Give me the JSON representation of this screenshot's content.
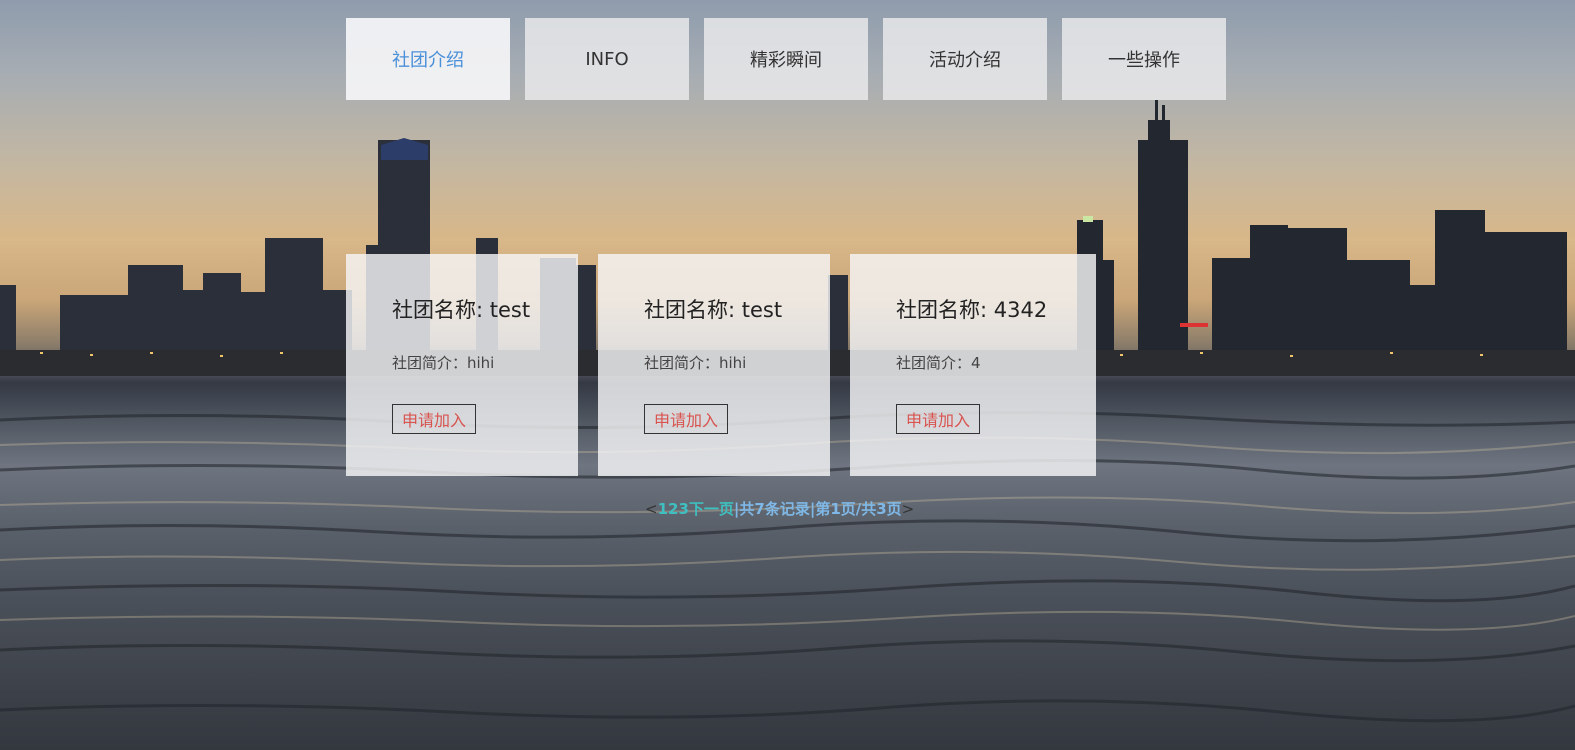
{
  "nav": {
    "items": [
      {
        "label": "社团介绍",
        "active": true
      },
      {
        "label": "INFO",
        "active": false
      },
      {
        "label": "精彩瞬间",
        "active": false
      },
      {
        "label": "活动介绍",
        "active": false
      },
      {
        "label": "一些操作",
        "active": false
      }
    ]
  },
  "clubs": [
    {
      "title": "社团名称: test",
      "desc": "社团简介：hihi",
      "button": "申请加入"
    },
    {
      "title": "社团名称: test",
      "desc": "社团简介：hihi",
      "button": "申请加入"
    },
    {
      "title": "社团名称: 4342",
      "desc": "社团简介：4",
      "button": "申请加入"
    }
  ],
  "pager": {
    "open": "<",
    "pages": [
      "1",
      "2",
      "3"
    ],
    "next": "下一页",
    "sep1": "|",
    "total": "共7条记录",
    "sep2": "|",
    "current": "第1页/共3页",
    "close": ">"
  },
  "colors": {
    "active_nav": "#4a90d9",
    "join_button_text": "#d9534f",
    "pager_link": "#3fbfbf",
    "pager_info": "#7fb8e6"
  }
}
